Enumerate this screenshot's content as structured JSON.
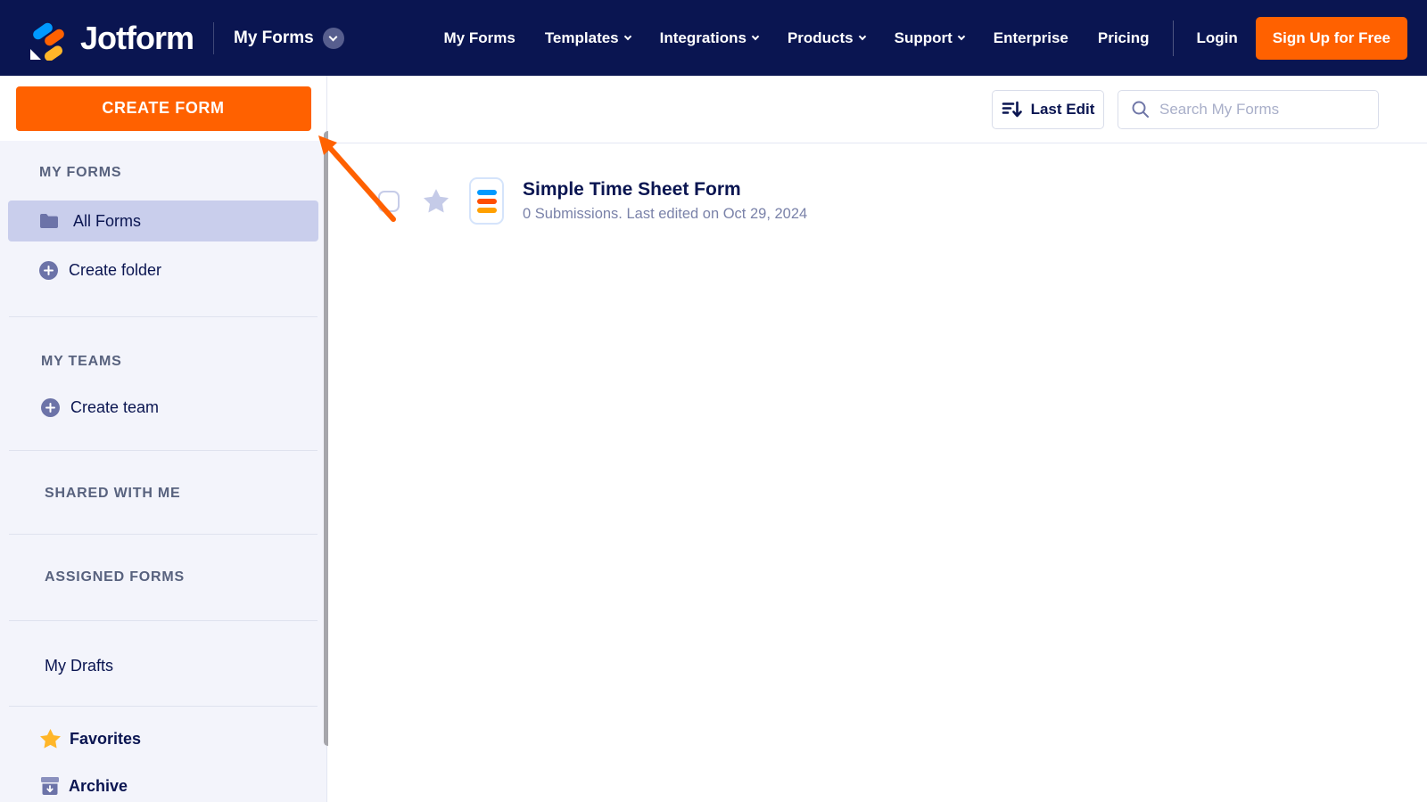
{
  "navbar": {
    "brand": "Jotform",
    "workspace_label": "My Forms",
    "links": [
      {
        "label": "My Forms",
        "chevron": false
      },
      {
        "label": "Templates",
        "chevron": true
      },
      {
        "label": "Integrations",
        "chevron": true
      },
      {
        "label": "Products",
        "chevron": true
      },
      {
        "label": "Support",
        "chevron": true
      },
      {
        "label": "Enterprise",
        "chevron": false
      },
      {
        "label": "Pricing",
        "chevron": false
      }
    ],
    "login_label": "Login",
    "signup_label": "Sign Up for Free"
  },
  "sidebar": {
    "create_form_label": "CREATE FORM",
    "my_forms_header": "MY FORMS",
    "all_forms_label": "All Forms",
    "create_folder_label": "Create folder",
    "my_teams_header": "MY TEAMS",
    "create_team_label": "Create team",
    "shared_header": "SHARED WITH ME",
    "assigned_header": "ASSIGNED FORMS",
    "my_drafts_label": "My Drafts",
    "favorites_label": "Favorites",
    "archive_label": "Archive"
  },
  "toolbar": {
    "sort_label": "Last Edit",
    "search_placeholder": "Search My Forms"
  },
  "forms": [
    {
      "title": "Simple Time Sheet Form",
      "meta": "0 Submissions. Last edited on Oct 29, 2024"
    }
  ],
  "colors": {
    "navy": "#0A1551",
    "orange": "#FF6100",
    "logo_blue": "#0099FF",
    "logo_yellow": "#FFB629",
    "favorites_star": "#FFB629",
    "sidebar_selected": "#C9CEEC",
    "icon_indigo": "#6C73A8"
  }
}
